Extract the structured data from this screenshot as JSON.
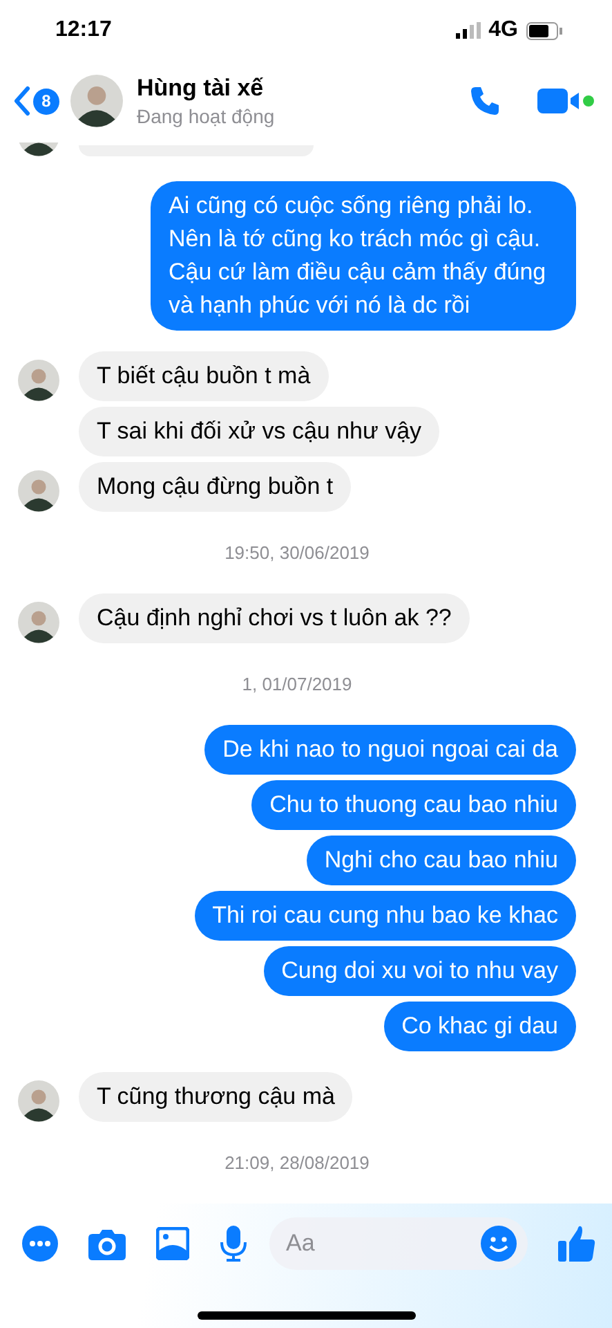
{
  "status_bar": {
    "time": "12:17",
    "network": "4G"
  },
  "header": {
    "back_badge": "8",
    "name": "Hùng tài xế",
    "status": "Đang hoạt động"
  },
  "messages": [
    {
      "kind": "partial",
      "show_avatar": true
    },
    {
      "kind": "outgoing",
      "text": "Ai cũng có cuộc sống riêng phải lo. Nên là tớ cũng ko trách móc gì cậu. Cậu cứ làm điều cậu cảm thấy đúng và hạnh phúc với nó là dc rồi"
    },
    {
      "kind": "incoming",
      "text": "T biết cậu buồn t mà",
      "show_avatar": true
    },
    {
      "kind": "incoming",
      "text": "T sai khi đối xử vs cậu như vậy",
      "show_avatar": false
    },
    {
      "kind": "incoming",
      "text": "Mong cậu đừng buồn t",
      "show_avatar": true
    },
    {
      "kind": "timestamp",
      "text": "19:50, 30/06/2019"
    },
    {
      "kind": "incoming",
      "text": "Cậu định nghỉ chơi vs t luôn ak ??",
      "show_avatar": true
    },
    {
      "kind": "timestamp",
      "text": "1, 01/07/2019"
    },
    {
      "kind": "outgoing",
      "text": "De khi nao to nguoi ngoai cai da"
    },
    {
      "kind": "outgoing",
      "text": "Chu to thuong cau bao nhiu"
    },
    {
      "kind": "outgoing",
      "text": "Nghi cho cau bao nhiu"
    },
    {
      "kind": "outgoing",
      "text": "Thi roi cau cung nhu bao ke khac"
    },
    {
      "kind": "outgoing",
      "text": "Cung doi xu voi to nhu vay"
    },
    {
      "kind": "outgoing",
      "text": "Co khac gi dau"
    },
    {
      "kind": "incoming",
      "text": "T cũng thương cậu mà",
      "show_avatar": true
    },
    {
      "kind": "timestamp",
      "text": "21:09, 28/08/2019"
    }
  ],
  "composer": {
    "placeholder": "Aa"
  }
}
